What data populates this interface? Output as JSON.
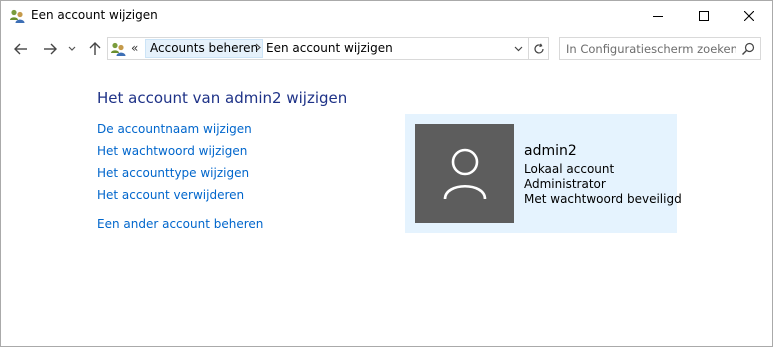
{
  "window": {
    "title": "Een account wijzigen"
  },
  "address": {
    "overflow_chevrons": "«",
    "crumbs": [
      "Accounts beheren",
      "Een account wijzigen"
    ]
  },
  "search": {
    "placeholder": "In Configuratiescherm zoeken"
  },
  "content": {
    "title": "Het account van admin2 wijzigen",
    "tasks": [
      "De accountnaam wijzigen",
      "Het wachtwoord wijzigen",
      "Het accounttype wijzigen",
      "Het account verwijderen"
    ],
    "other_task": "Een ander account beheren"
  },
  "account": {
    "name": "admin2",
    "type": "Lokaal account",
    "role": "Administrator",
    "password_status": "Met wachtwoord beveiligd"
  },
  "colors": {
    "title_blue": "#1e3287",
    "link_blue": "#0066cc",
    "card_bg": "#e5f3fe",
    "avatar_bg": "#5d5d5d",
    "breadcrumb_highlight": "#e5f1fb"
  },
  "icons": {
    "app": "user-accounts-icon",
    "back": "arrow-left-icon",
    "forward": "arrow-right-icon",
    "recent": "chevron-down-icon",
    "up": "arrow-up-icon",
    "dropdown": "chevron-down-icon",
    "refresh": "refresh-icon",
    "search": "search-icon",
    "avatar": "user-silhouette-icon"
  }
}
